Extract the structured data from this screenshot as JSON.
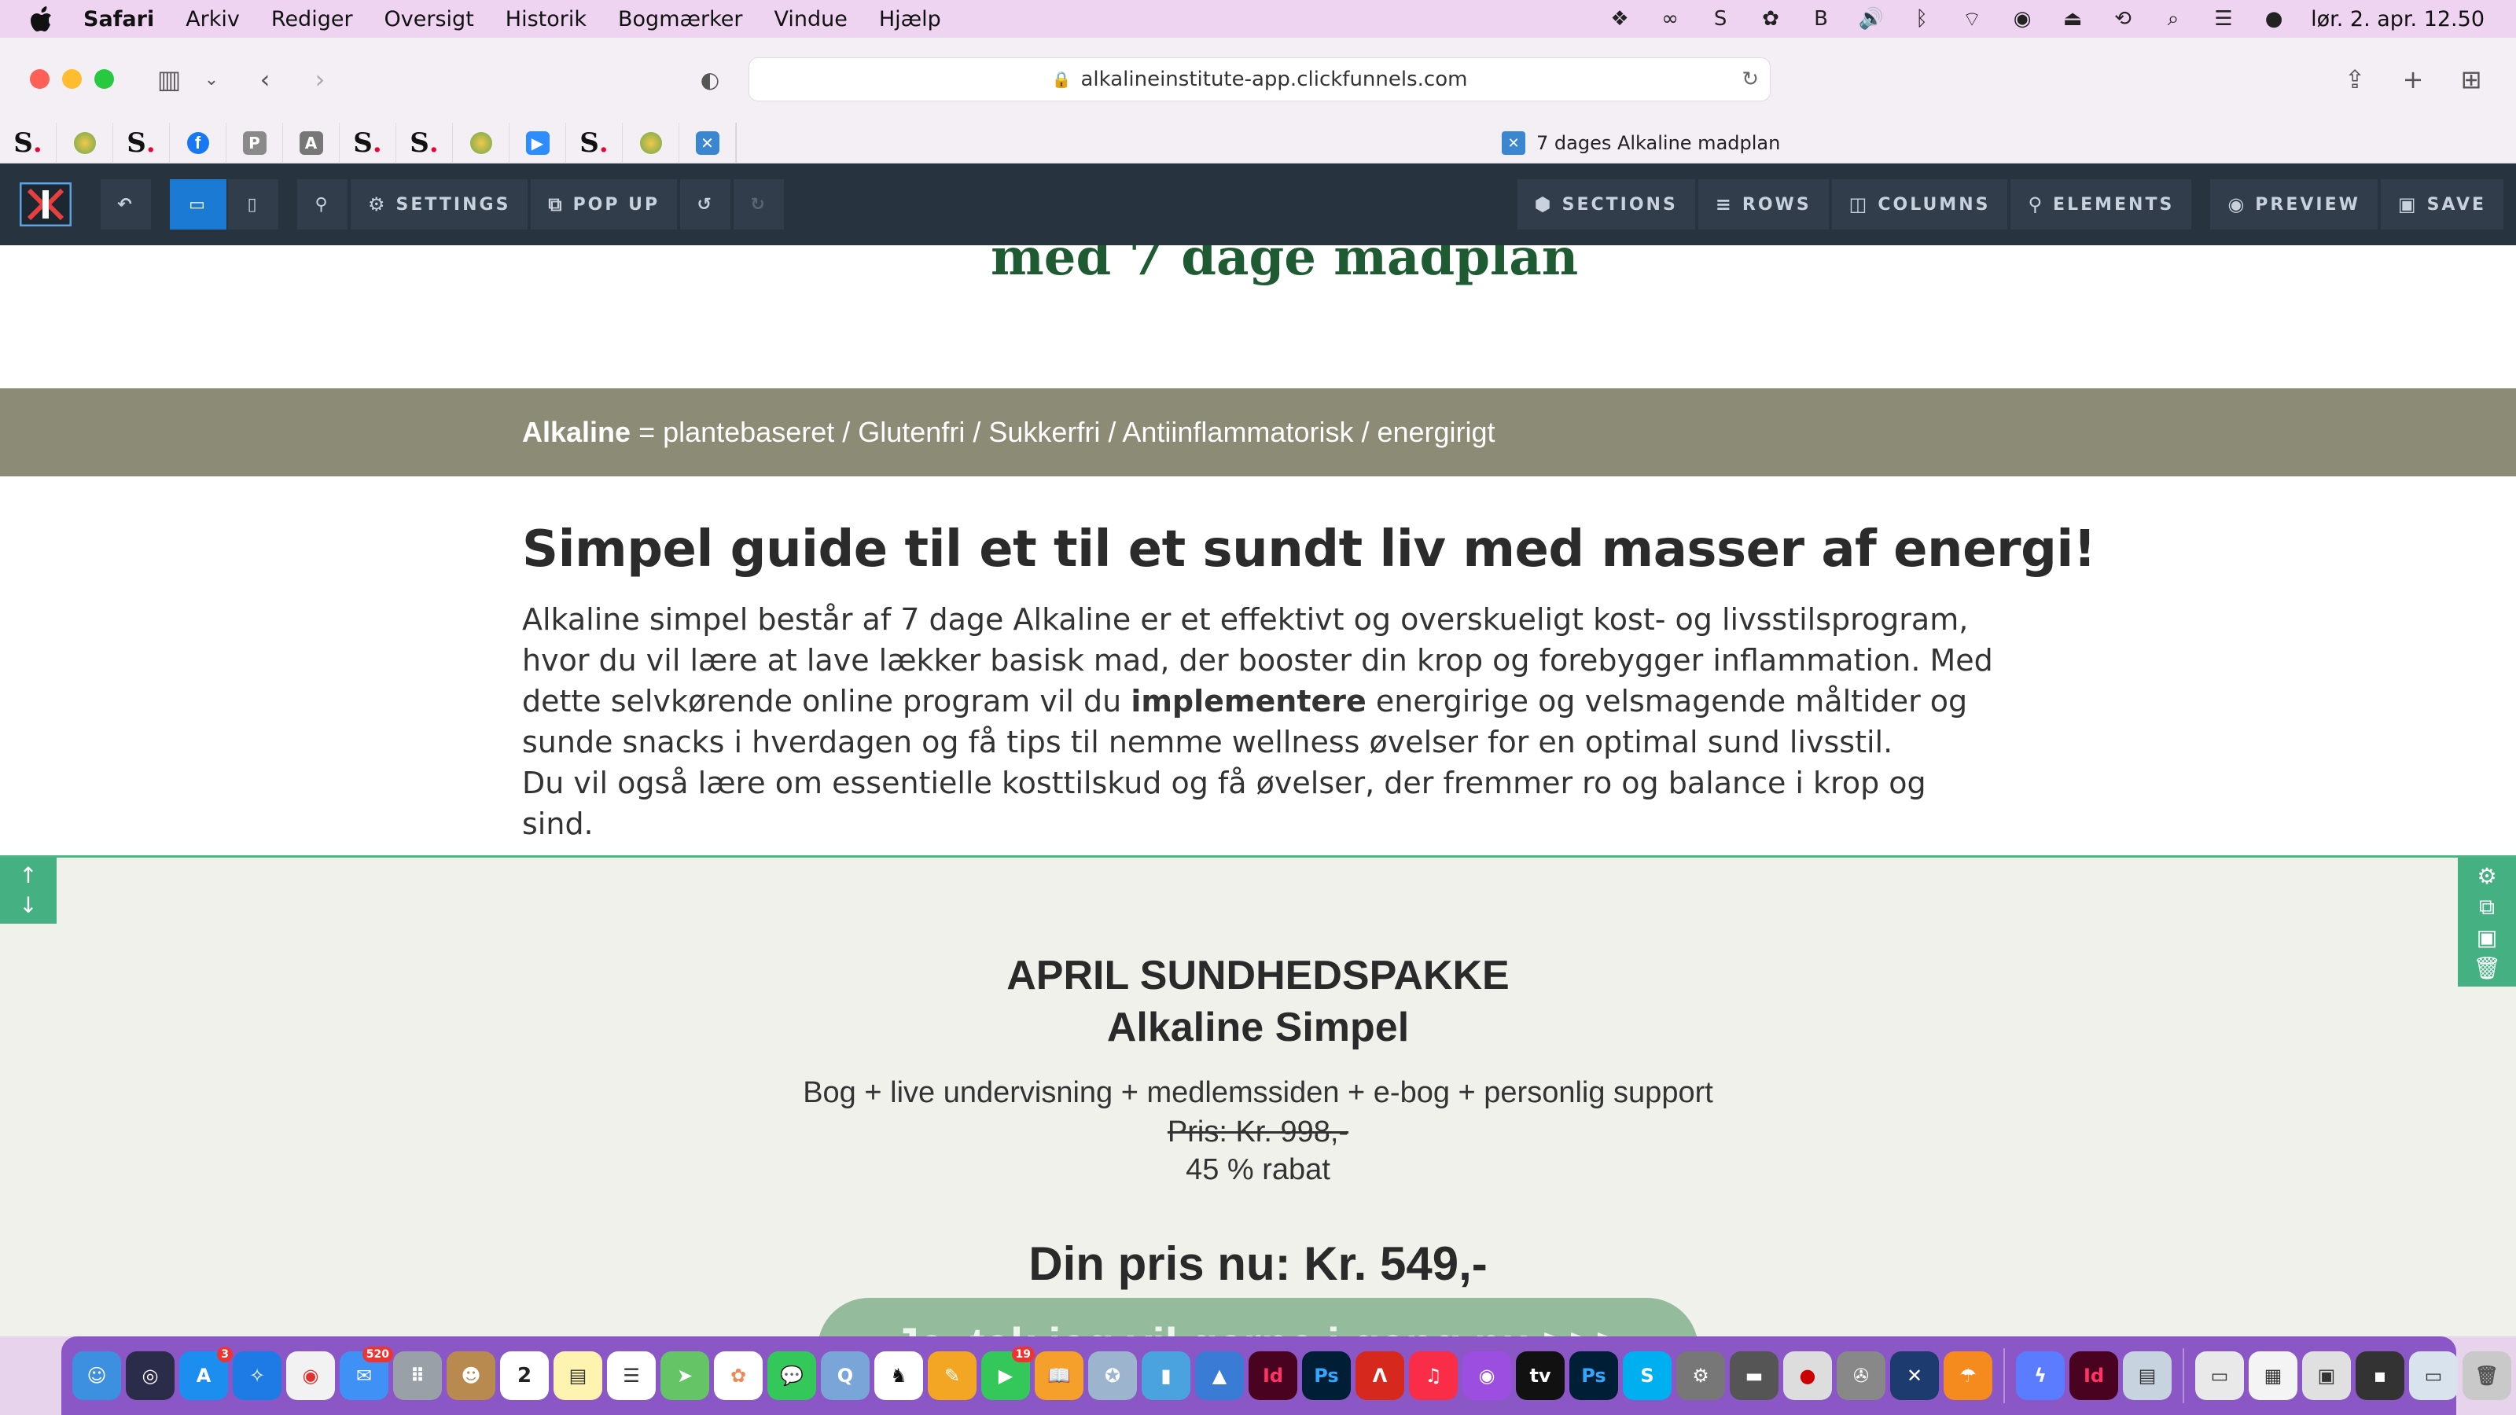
{
  "menubar": {
    "app_name": "Safari",
    "items": [
      "Arkiv",
      "Rediger",
      "Oversigt",
      "Historik",
      "Bogmærker",
      "Vindue",
      "Hjælp"
    ],
    "clock": "lør. 2. apr. 12.50"
  },
  "browser": {
    "url": "alkalineinstitute-app.clickfunnels.com",
    "tab_title": "7 dages Alkaline madplan",
    "bookmarks": [
      "S.",
      "",
      "S.",
      "",
      "P",
      "A",
      "S.",
      "S.",
      "",
      "",
      "S.",
      "",
      ""
    ]
  },
  "editor": {
    "settings": "SETTINGS",
    "popup": "POP UP",
    "sections": "SECTIONS",
    "rows": "ROWS",
    "columns": "COLUMNS",
    "elements": "ELEMENTS",
    "preview": "PREVIEW",
    "save": "SAVE"
  },
  "page": {
    "headline_cut": "med 7 dage madplan",
    "tagline_bold": "Alkaline",
    "tagline_rest": "= plantebaseret  / Glutenfri / Sukkerfri / Antiinflammatorisk / energirigt",
    "guide_title": "Simpel guide til et til et sundt liv med masser af energi!",
    "guide_p1_a": "Alkaline simpel består af 7 dage Alkaline er et effektivt og overskueligt kost- og livsstilsprogram, hvor du vil lære at lave lækker basisk mad, der booster din krop og forebygger inflammation. Med dette selvkørende online program vil du ",
    "guide_p1_bold": "implementere",
    "guide_p1_b": " energirige og velsmagende måltider og sunde snacks i hverdagen og få tips til nemme wellness øvelser for en optimal sund livsstil.",
    "guide_p2": "Du vil også lære om essentielle kosttilskud og få øvelser, der fremmer ro og balance i krop og sind.",
    "pkg_title": "APRIL SUNDHEDSPAKKE",
    "pkg_subtitle": "Alkaline Simpel",
    "pkg_items": "Bog  + live undervisning + medlemssiden + e-bog + personlig support",
    "pkg_old_price": "Pris: Kr. 998,-",
    "pkg_discount": "45 % rabat",
    "pkg_price": "Din pris nu: Kr. 549,-",
    "cta": "Ja, tak jeg vil gerne i gang nu >>>"
  },
  "dock": {
    "badges": {
      "appstore": "3",
      "mail": "520",
      "calendar": "2",
      "facetime": "19"
    }
  },
  "colors": {
    "menubar": "#eed4f1",
    "editor_bar": "#283340",
    "active_blue": "#1a7ad4",
    "tagline_bg": "#8c8b76",
    "section_bg": "#f1f1ec",
    "cta_bg": "#94bb9b",
    "section_tools": "#45b183",
    "dock": "#8b57c6"
  }
}
